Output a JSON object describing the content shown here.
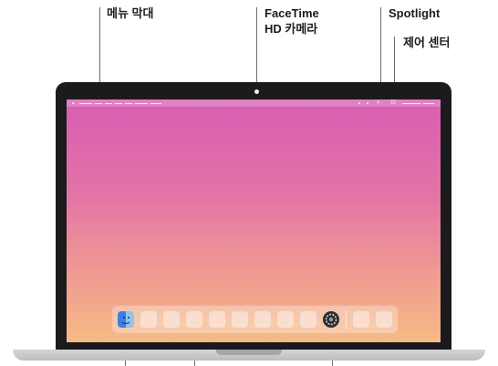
{
  "callouts": {
    "menu_bar": "메뉴 막대",
    "facetime_line1": "FaceTime",
    "facetime_line2": "HD 카메라",
    "spotlight": "Spotlight",
    "control_center": "제어 센터"
  },
  "colors": {
    "bezel": "#1b1b1d",
    "wallpaper_top": "#d85db4",
    "wallpaper_bottom": "#f6bb84",
    "callout_line": "#6e6e73"
  },
  "dock": {
    "icons": [
      "finder-icon",
      "app-icon",
      "app-icon",
      "app-icon",
      "app-icon",
      "app-icon",
      "app-icon",
      "app-icon",
      "app-icon",
      "system-settings-icon",
      "app-icon",
      "app-icon"
    ]
  },
  "menubar_icons": [
    "wifi-icon",
    "battery-icon",
    "search-icon",
    "control-center-icon"
  ]
}
